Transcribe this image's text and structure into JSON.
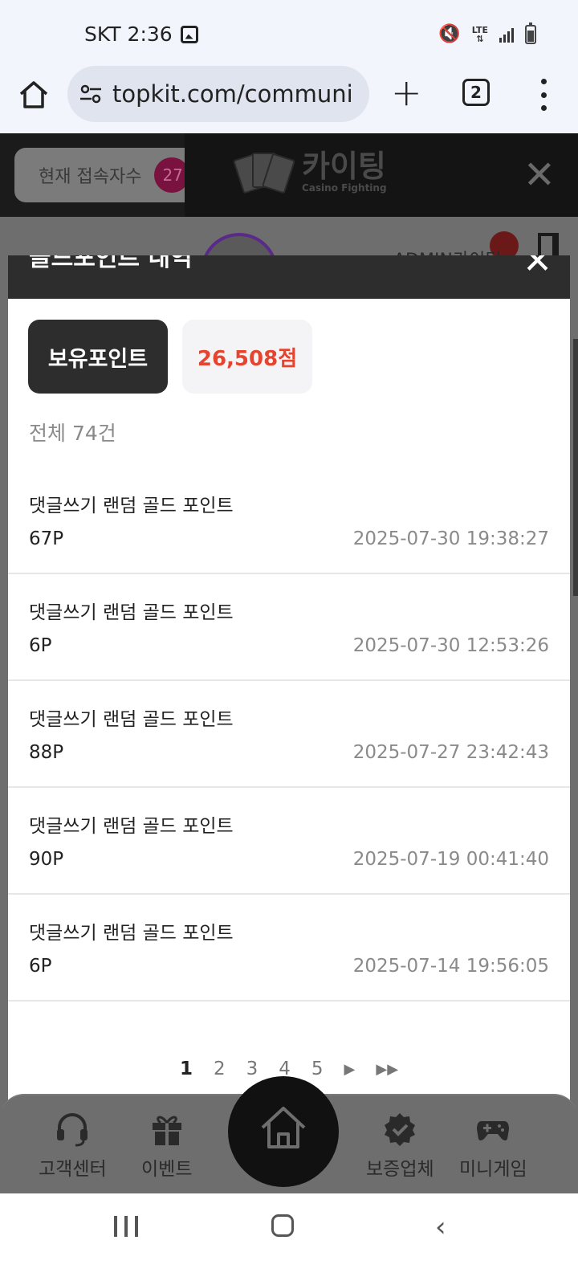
{
  "status_bar": {
    "carrier_time": "SKT 2:36",
    "network": "LTE"
  },
  "browser": {
    "url": "topkit.com/community/",
    "tab_count": "2"
  },
  "background_page": {
    "visitors_label": "현재 접속자수",
    "visitors_count": "27",
    "logo_title": "카이팅",
    "logo_subtitle": "Casino Fighting",
    "admin_text": "ADMIN카이팅"
  },
  "modal": {
    "title": "골드포인트 내역",
    "points_label": "보유포인트",
    "points_value": "26,508점",
    "total": "전체 74건",
    "items": [
      {
        "title": "댓글쓰기 랜덤 골드 포인트",
        "amount": "67P",
        "date": "2025-07-30 19:38:27"
      },
      {
        "title": "댓글쓰기 랜덤 골드 포인트",
        "amount": "6P",
        "date": "2025-07-30 12:53:26"
      },
      {
        "title": "댓글쓰기 랜덤 골드 포인트",
        "amount": "88P",
        "date": "2025-07-27 23:42:43"
      },
      {
        "title": "댓글쓰기 랜덤 골드 포인트",
        "amount": "90P",
        "date": "2025-07-19 00:41:40"
      },
      {
        "title": "댓글쓰기 랜덤 골드 포인트",
        "amount": "6P",
        "date": "2025-07-14 19:56:05"
      }
    ],
    "pages": [
      "1",
      "2",
      "3",
      "4",
      "5"
    ],
    "current_page": "1"
  },
  "bottom_nav": {
    "customer_center": "고객센터",
    "event": "이벤트",
    "guaranteed": "보증업체",
    "minigame": "미니게임"
  },
  "colors": {
    "accent_red": "#e5442f",
    "dark": "#2d2d2d"
  }
}
